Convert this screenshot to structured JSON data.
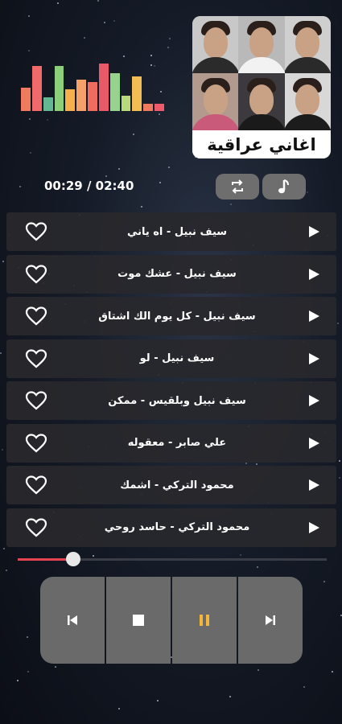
{
  "album": {
    "title": "اغاني عراقية"
  },
  "player": {
    "time_display": "00:29 / 02:40",
    "progress_fraction": 0.18,
    "state": "playing"
  },
  "equalizer": {
    "levels": [
      0.48,
      0.93,
      0.28,
      0.93,
      0.45,
      0.65,
      0.6,
      0.98,
      0.78,
      0.32,
      0.72,
      0.15,
      0.15
    ],
    "colors": [
      "#f07a5d",
      "#f06a6a",
      "#63b893",
      "#8ccf7a",
      "#f3b04c",
      "#f6a06a",
      "#ef6c5f",
      "#e85a67",
      "#96d38c",
      "#b9d97a",
      "#f2bd55",
      "#f07a5d",
      "#ef5b6a"
    ]
  },
  "songs": [
    "سيف نبيل - اه ياني",
    "سيف نبيل - عشك موت",
    "سيف نبيل - كل يوم الك اشتاق",
    "سيف نبيل - لو",
    "سيف نبيل وبلقيس - ممكن",
    "علي صابر - معقوله",
    "محمود التركي - اشمك",
    "محمود التركي - حاسد روحي"
  ],
  "colors": {
    "accent": "#e5434f",
    "pause": "#f2b73a",
    "row_bg": "#28282c",
    "control_bg": "#6a6a6a"
  },
  "icons": {
    "toolbar": [
      "repeat-icon",
      "music-note-icon"
    ],
    "row": [
      "heart-icon",
      "play-icon"
    ],
    "controls": [
      "skip-previous-icon",
      "stop-icon",
      "pause-icon",
      "skip-next-icon"
    ]
  }
}
